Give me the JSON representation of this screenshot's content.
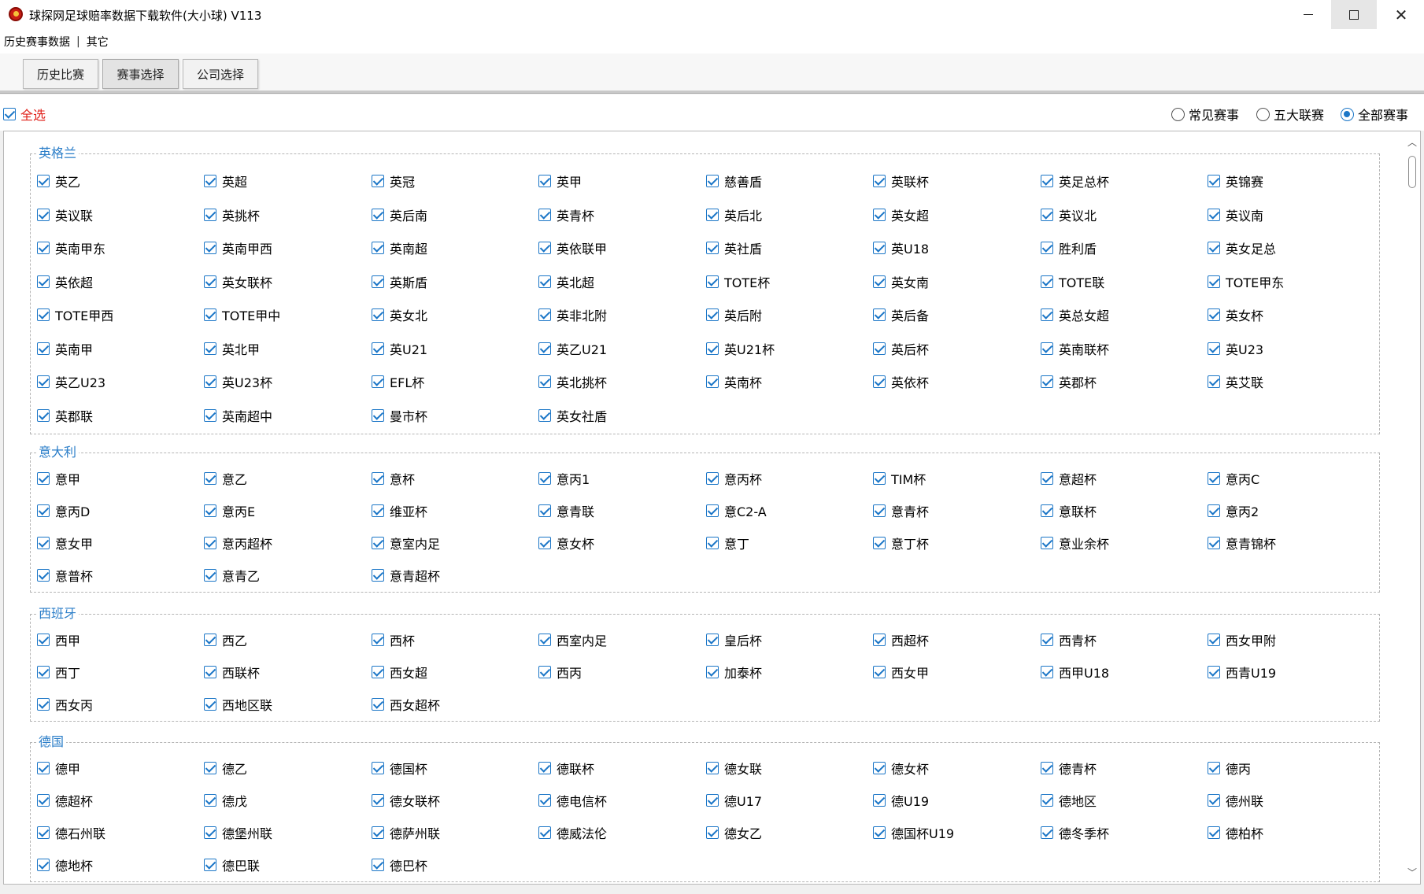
{
  "window": {
    "title": "球探网足球赔率数据下载软件(大小球) V113",
    "icon": "soccer-ball-app-icon",
    "minimize_glyph": "",
    "close_glyph": "✕"
  },
  "menu": {
    "items": [
      "历史赛事数据",
      "其它"
    ],
    "separator": "|"
  },
  "tabs": [
    {
      "label": "历史比赛"
    },
    {
      "label": "赛事选择",
      "active": true
    },
    {
      "label": "公司选择"
    }
  ],
  "options": {
    "select_all_label": "全选",
    "select_all_checked": true,
    "radios": [
      {
        "label": "常见赛事",
        "selected": false
      },
      {
        "label": "五大联赛",
        "selected": false
      },
      {
        "label": "全部赛事",
        "selected": true
      }
    ]
  },
  "groups": [
    {
      "title": "英格兰",
      "items": [
        "英乙",
        "英超",
        "英冠",
        "英甲",
        "慈善盾",
        "英联杯",
        "英足总杯",
        "英锦赛",
        "英议联",
        "英挑杯",
        "英后南",
        "英青杯",
        "英后北",
        "英女超",
        "英议北",
        "英议南",
        "英南甲东",
        "英南甲西",
        "英南超",
        "英依联甲",
        "英社盾",
        "英U18",
        "胜利盾",
        "英女足总",
        "英依超",
        "英女联杯",
        "英斯盾",
        "英北超",
        "TOTE杯",
        "英女南",
        "TOTE联",
        "TOTE甲东",
        "TOTE甲西",
        "TOTE甲中",
        "英女北",
        "英非北附",
        "英后附",
        "英后备",
        "英总女超",
        "英女杯",
        "英南甲",
        "英北甲",
        "英U21",
        "英乙U21",
        "英U21杯",
        "英后杯",
        "英南联杯",
        "英U23",
        "英乙U23",
        "英U23杯",
        "EFL杯",
        "英北挑杯",
        "英南杯",
        "英依杯",
        "英郡杯",
        "英艾联",
        "英郡联",
        "英南超中",
        "曼市杯",
        "英女社盾"
      ]
    },
    {
      "title": "意大利",
      "items": [
        "意甲",
        "意乙",
        "意杯",
        "意丙1",
        "意丙杯",
        "TIM杯",
        "意超杯",
        "意丙C",
        "意丙D",
        "意丙E",
        "维亚杯",
        "意青联",
        "意C2-A",
        "意青杯",
        "意联杯",
        "意丙2",
        "意女甲",
        "意丙超杯",
        "意室内足",
        "意女杯",
        "意丁",
        "意丁杯",
        "意业余杯",
        "意青锦杯",
        "意普杯",
        "意青乙",
        "意青超杯"
      ]
    },
    {
      "title": "西班牙",
      "items": [
        "西甲",
        "西乙",
        "西杯",
        "西室内足",
        "皇后杯",
        "西超杯",
        "西青杯",
        "西女甲附",
        "西丁",
        "西联杯",
        "西女超",
        "西丙",
        "加泰杯",
        "西女甲",
        "西甲U18",
        "西青U19",
        "西女丙",
        "西地区联",
        "西女超杯"
      ]
    },
    {
      "title": "德国",
      "items": [
        "德甲",
        "德乙",
        "德国杯",
        "德联杯",
        "德女联",
        "德女杯",
        "德青杯",
        "德丙",
        "德超杯",
        "德戊",
        "德女联杯",
        "德电信杯",
        "德U17",
        "德U19",
        "德地区",
        "德州联",
        "德石州联",
        "德堡州联",
        "德萨州联",
        "德威法伦",
        "德女乙",
        "德国杯U19",
        "德冬季杯",
        "德柏杯",
        "德地杯",
        "德巴联",
        "德巴杯"
      ]
    }
  ],
  "scrollbar": {
    "up_glyph": "︿",
    "down_glyph": "﹀"
  }
}
